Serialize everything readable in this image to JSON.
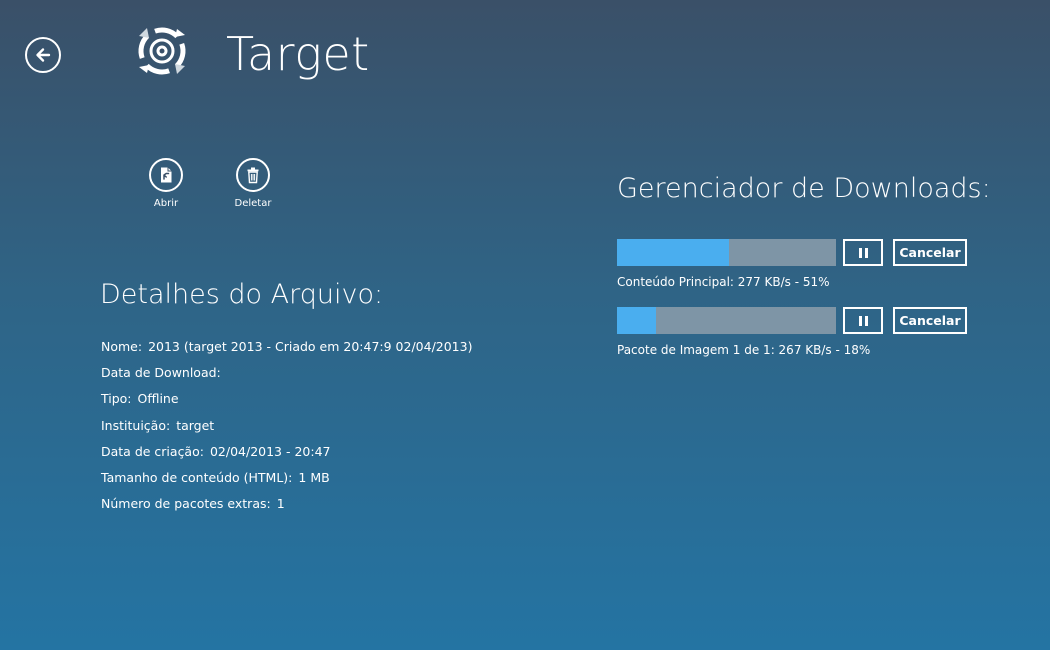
{
  "header": {
    "title": "Target"
  },
  "commands": {
    "open_label": "Abrir",
    "delete_label": "Deletar"
  },
  "details": {
    "title": "Detalhes do Arquivo:",
    "rows": [
      {
        "label": "Nome:",
        "value": "2013 (target 2013 - Criado em 20:47:9 02/04/2013)"
      },
      {
        "label": "Data de Download:",
        "value": ""
      },
      {
        "label": "Tipo:",
        "value": "Offline"
      },
      {
        "label": "Instituição:",
        "value": "target"
      },
      {
        "label": "Data de criação:",
        "value": "02/04/2013 - 20:47"
      },
      {
        "label": "Tamanho de conteúdo (HTML):",
        "value": "1 MB"
      },
      {
        "label": "Número de pacotes extras:",
        "value": "1"
      }
    ]
  },
  "downloads": {
    "title": "Gerenciador de Downloads:",
    "items": [
      {
        "status": "Conteúdo Principal: 277 KB/s - 51%",
        "progress": 0.51,
        "cancel_label": "Cancelar"
      },
      {
        "status": "Pacote de Imagem 1 de 1: 267 KB/s - 18%",
        "progress": 0.18,
        "cancel_label": "Cancelar"
      }
    ]
  },
  "colors": {
    "progress_fill": "#4aaeef",
    "progress_track": "#7e95a6",
    "background_top": "#3a5068",
    "background_bottom": "#2474a3"
  },
  "icons": {
    "back": "back-arrow-icon",
    "logo": "target-sync-logo-icon",
    "open": "open-file-icon",
    "delete": "trash-icon",
    "pause": "pause-icon"
  }
}
